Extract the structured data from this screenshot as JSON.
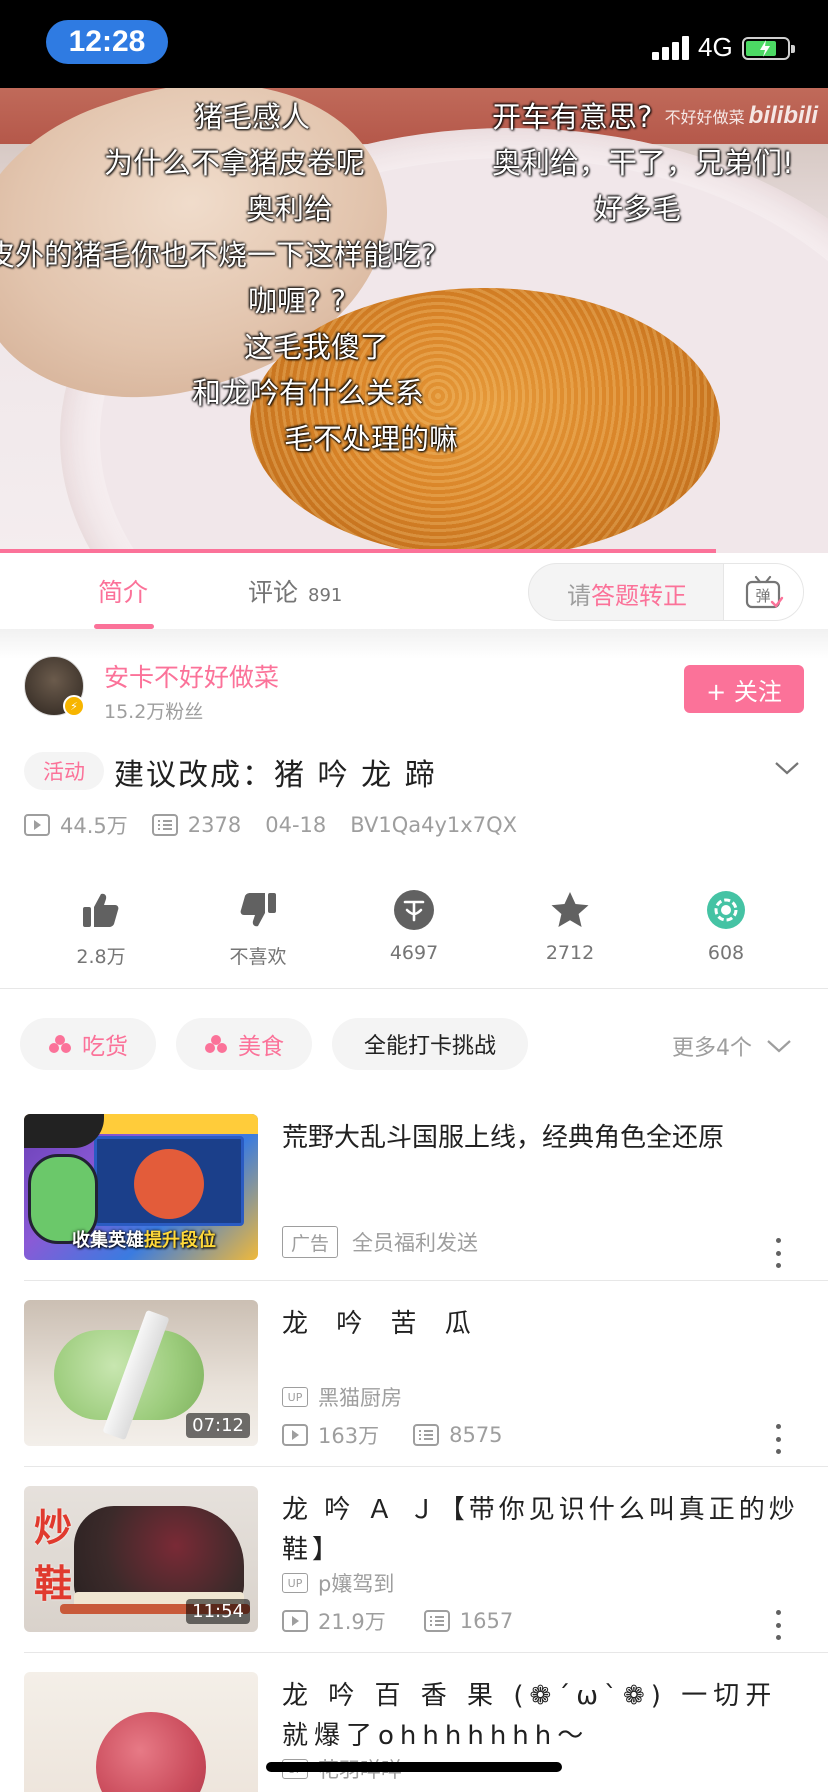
{
  "status_bar": {
    "time": "12:28",
    "network": "4G"
  },
  "video": {
    "watermark_text": "不好好做菜",
    "watermark_logo": "bilibili",
    "progress_fraction": 0.865,
    "danmaku": [
      "猪毛感人",
      "开车有意思?",
      "为什么不拿猪皮卷呢",
      "奥利给，干了，兄弟们!",
      "奥利给",
      "好多毛",
      "皮外的猪毛你也不烧一下这样能吃?",
      "咖喱? ?",
      "这毛我傻了",
      "和龙吟有什么关系",
      "毛不处理的嘛"
    ]
  },
  "tabs": {
    "intro_label": "简介",
    "comment_label": "评论",
    "comment_count": "891",
    "danmaku_prefix": "请",
    "danmaku_highlight": "答题转正",
    "danmaku_toggle_glyph": "弹"
  },
  "uploader": {
    "name": "安卡不好好做菜",
    "fans": "15.2万粉丝",
    "follow_label": "+ 关注"
  },
  "info": {
    "activity_tag": "活动",
    "title": "建议改成：猪 吟 龙 蹄",
    "views": "44.5万",
    "danmaku_count": "2378",
    "date": "04-18",
    "bvid": "BV1Qa4y1x7QX"
  },
  "actions": [
    {
      "icon": "thumb-up-icon",
      "label": "2.8万"
    },
    {
      "icon": "thumb-down-icon",
      "label": "不喜欢"
    },
    {
      "icon": "coin-icon",
      "label": "4697"
    },
    {
      "icon": "star-icon",
      "label": "2712"
    },
    {
      "icon": "share-icon",
      "label": "608"
    }
  ],
  "tags": [
    {
      "label": "吃货",
      "style": "pink"
    },
    {
      "label": "美食",
      "style": "pink"
    },
    {
      "label": "全能打卡挑战",
      "style": "dark"
    }
  ],
  "more_tags": "更多4个",
  "related": [
    {
      "title": "荒野大乱斗国服上线，经典角色全还原",
      "ad_label": "广告",
      "ad_desc": "全员福利发送",
      "thumb_text_1": "收集英雄",
      "thumb_text_2": "提升段位"
    },
    {
      "title": "龙 吟 苦 瓜",
      "up_badge": "UP",
      "up": "黑猫厨房",
      "duration": "07:12",
      "views": "163万",
      "danmaku": "8575"
    },
    {
      "title": "龙 吟 Ａ Ｊ【带你见识什么叫真正的炒鞋】",
      "up_badge": "UP",
      "up": "p孃驾到",
      "duration": "11:54",
      "views": "21.9万",
      "danmaku": "1657",
      "thumb_text": "炒鞋"
    },
    {
      "title": "龙 吟 百 香 果 (❁´ω`❁) 一切开就爆了ohhhhhhh～",
      "up_badge": "UP",
      "up": "花羽咩咩"
    }
  ],
  "colors": {
    "accent": "#fb7299",
    "text": "#212121",
    "muted": "#9e9e9e",
    "blue_pill": "#2f7be2"
  }
}
